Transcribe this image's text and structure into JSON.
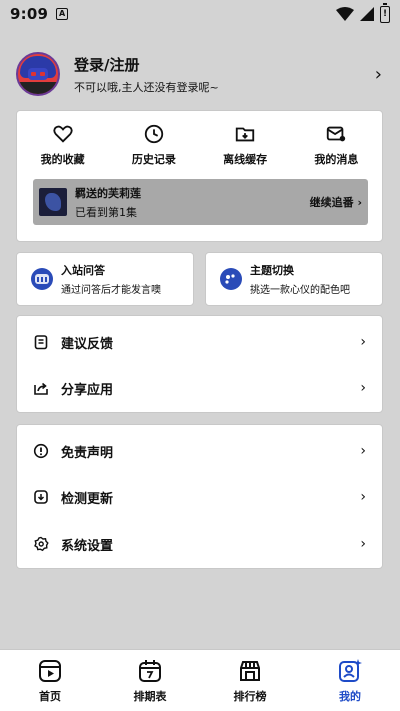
{
  "status_bar": {
    "time": "9:09",
    "notif_letter": "A"
  },
  "profile": {
    "title": "登录/注册",
    "subtitle": "不可以哦,主人还没有登录呢~",
    "arrow": "›"
  },
  "quick_actions": [
    {
      "label": "我的收藏",
      "icon": "heart-icon"
    },
    {
      "label": "历史记录",
      "icon": "history-clock-icon"
    },
    {
      "label": "离线缓存",
      "icon": "folder-download-icon"
    },
    {
      "label": "我的消息",
      "icon": "message-mail-icon"
    }
  ],
  "continue_watching": {
    "title": "羁送的芙莉莲",
    "progress": "已看到第1集",
    "action": "继续追番 ›"
  },
  "promos": [
    {
      "title": "入站问答",
      "subtitle": "通过问答后才能发言噢",
      "icon": "quiz-icon"
    },
    {
      "title": "主题切换",
      "subtitle": "挑选一款心仪的配色吧",
      "icon": "palette-icon"
    }
  ],
  "menu_group_1": [
    {
      "label": "建议反馈",
      "icon": "feedback-icon"
    },
    {
      "label": "分享应用",
      "icon": "share-icon"
    }
  ],
  "menu_group_2": [
    {
      "label": "免责声明",
      "icon": "info-icon"
    },
    {
      "label": "检测更新",
      "icon": "update-icon"
    },
    {
      "label": "系统设置",
      "icon": "gear-icon"
    }
  ],
  "row_arrow": "›",
  "bottom_nav": [
    {
      "label": "首页",
      "icon": "home-play-icon",
      "active": false
    },
    {
      "label": "排期表",
      "icon": "calendar-icon",
      "active": false
    },
    {
      "label": "排行榜",
      "icon": "ranking-icon",
      "active": false
    },
    {
      "label": "我的",
      "icon": "profile-icon",
      "active": true
    }
  ],
  "colors": {
    "accent": "#1e4bc7",
    "background": "#d3d3d3",
    "card": "#ffffff"
  }
}
